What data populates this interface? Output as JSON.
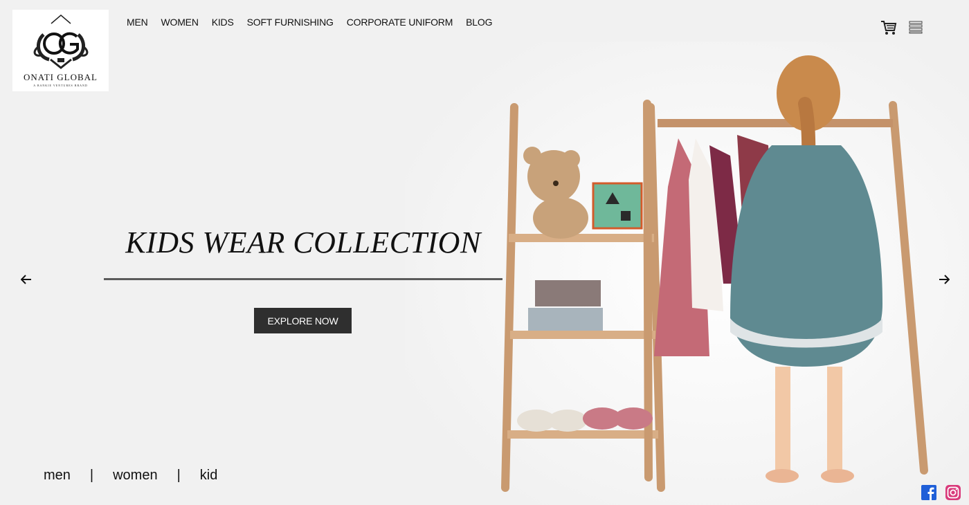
{
  "brand": {
    "name": "ONATI GLOBAL",
    "tagline": "A BANKIE VENTURES BRAND",
    "monogram": "OG"
  },
  "nav": {
    "items": [
      "MEN",
      "WOMEN",
      "KIDS",
      "SOFT FURNISHING",
      "CORPORATE UNIFORM",
      "BLOG"
    ]
  },
  "header_icons": [
    "cart-icon",
    "menu-icon"
  ],
  "hero": {
    "title": "KIDS WEAR COLLECTION",
    "button_label": "EXPLORE NOW",
    "prev_icon": "arrow-left-icon",
    "next_icon": "arrow-right-icon"
  },
  "categories": [
    "men",
    "women",
    "kid"
  ],
  "category_separator": "|",
  "social": [
    "facebook-icon",
    "instagram-icon"
  ],
  "colors": {
    "background": "#f1f1f1",
    "button": "#2f2f2f",
    "facebook": "#1f5fd8",
    "instagram": "#d93a7b"
  }
}
